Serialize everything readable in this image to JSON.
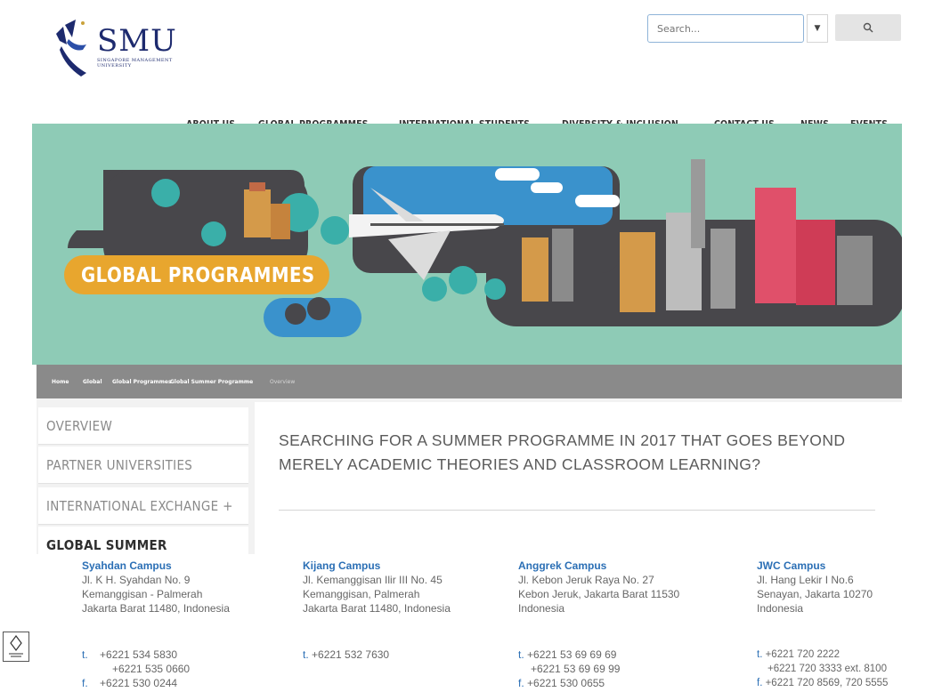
{
  "logo": {
    "wordmark": "SMU",
    "subtitle": "SINGAPORE MANAGEMENT UNIVERSITY"
  },
  "search": {
    "placeholder": "Search..."
  },
  "nav": {
    "items": [
      "ABOUT US",
      "GLOBAL PROGRAMMES",
      "INTERNATIONAL STUDENTS",
      "DIVERSITY & INCLUSION",
      "CONTACT US",
      "NEWS",
      "EVENTS"
    ],
    "active": "GLOBAL PROGRAMMES"
  },
  "banner": {
    "title": "GLOBAL PROGRAMMES"
  },
  "breadcrumb": [
    "Home",
    "Global",
    "Global Programmes",
    "Global Summer Programme",
    "Overview"
  ],
  "sidebar": {
    "items": [
      "OVERVIEW",
      "PARTNER UNIVERSITIES",
      "INTERNATIONAL EXCHANGE",
      "GLOBAL SUMMER"
    ],
    "expand_symbol": "+"
  },
  "main": {
    "heading": "SEARCHING FOR A SUMMER PROGRAMME IN 2017 THAT GOES BEYOND MERELY ACADEMIC THEORIES AND CLASSROOM LEARNING?"
  },
  "footer": {
    "campuses": [
      {
        "name": "Syahdan Campus",
        "address": [
          "Jl. K H. Syahdan No. 9",
          "Kemanggisan - Palmerah",
          "Jakarta Barat 11480, Indonesia"
        ],
        "phones": [
          "+6221 534 5830",
          "+6221 535 0660",
          "+6221 530 0244"
        ]
      },
      {
        "name": "Kijang Campus",
        "address": [
          "Jl. Kemanggisan Ilir III No. 45",
          "Kemanggisan, Palmerah",
          "Jakarta Barat 11480, Indonesia"
        ],
        "phones": [
          "+6221 532 7630"
        ]
      },
      {
        "name": "Anggrek Campus",
        "address": [
          "Jl. Kebon Jeruk Raya No. 27",
          "Kebon Jeruk, Jakarta Barat 11530",
          "Indonesia"
        ],
        "phones": [
          "+6221 53 69 69 69",
          "+6221 53 69 69 99",
          "+6221 530 0655"
        ]
      },
      {
        "name": "JWC Campus",
        "address": [
          "Jl. Hang Lekir I No.6",
          "Senayan, Jakarta 10270",
          "Indonesia"
        ],
        "phones": [
          "+6221 720 2222",
          "+6221 720 3333 ext. 8100",
          "+6221 720 8569, 720 5555"
        ]
      }
    ],
    "phone_label": "t.",
    "fax_label": "f."
  },
  "colors": {
    "brand_navy": "#1d2a6e",
    "banner_teal": "#8ecbb6",
    "banner_pill": "#e8a62e",
    "link_blue": "#2b6fb5",
    "breadcrumb_bg": "#8a8a8a"
  }
}
